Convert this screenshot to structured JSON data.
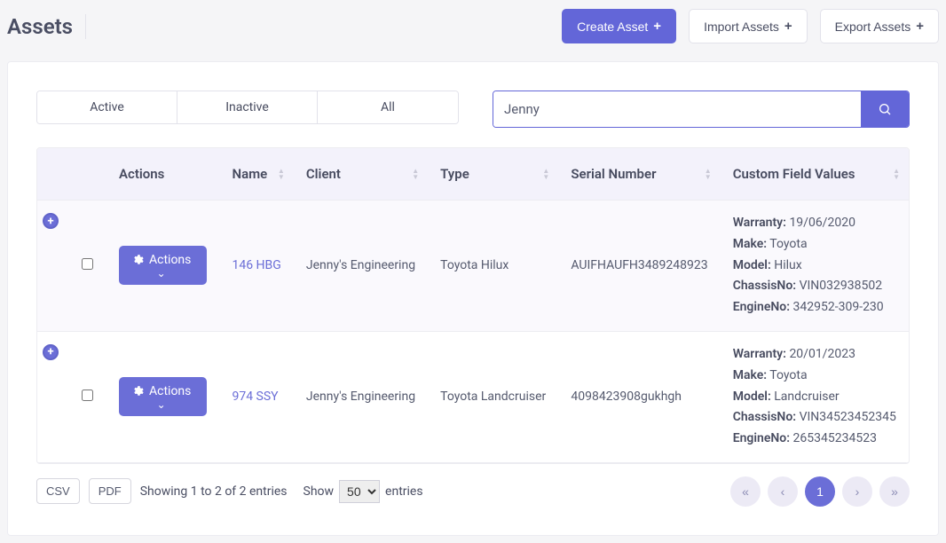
{
  "page": {
    "title": "Assets"
  },
  "toolbar": {
    "create_label": "Create Asset",
    "import_label": "Import Assets",
    "export_label": "Export Assets"
  },
  "tabs": {
    "active": "Active",
    "inactive": "Inactive",
    "all": "All"
  },
  "search": {
    "value": "Jenny"
  },
  "table": {
    "headers": {
      "actions": "Actions",
      "name": "Name",
      "client": "Client",
      "type": "Type",
      "serial": "Serial Number",
      "custom": "Custom Field Values"
    },
    "actions_label": "Actions",
    "rows": [
      {
        "name": "146 HBG",
        "client": "Jenny's Engineering",
        "type": "Toyota Hilux",
        "serial": "AUIFHAUFH3489248923",
        "cfv": {
          "warranty": "19/06/2020",
          "make": "Toyota",
          "model": "Hilux",
          "chassis": "VIN032938502",
          "engine": "342952-309-230"
        }
      },
      {
        "name": "974 SSY",
        "client": "Jenny's Engineering",
        "type": "Toyota Landcruiser",
        "serial": "4098423908gukhgh",
        "cfv": {
          "warranty": "20/01/2023",
          "make": "Toyota",
          "model": "Landcruiser",
          "chassis": "VIN34523452345",
          "engine": "265345234523"
        }
      }
    ],
    "cfv_labels": {
      "warranty": "Warranty:",
      "make": "Make:",
      "model": "Model:",
      "chassis": "ChassisNo:",
      "engine": "EngineNo:"
    }
  },
  "footer": {
    "csv": "CSV",
    "pdf": "PDF",
    "info": "Showing 1 to 2 of 2 entries",
    "show": "Show",
    "entries": "entries",
    "page_size": "50",
    "current_page": "1"
  }
}
